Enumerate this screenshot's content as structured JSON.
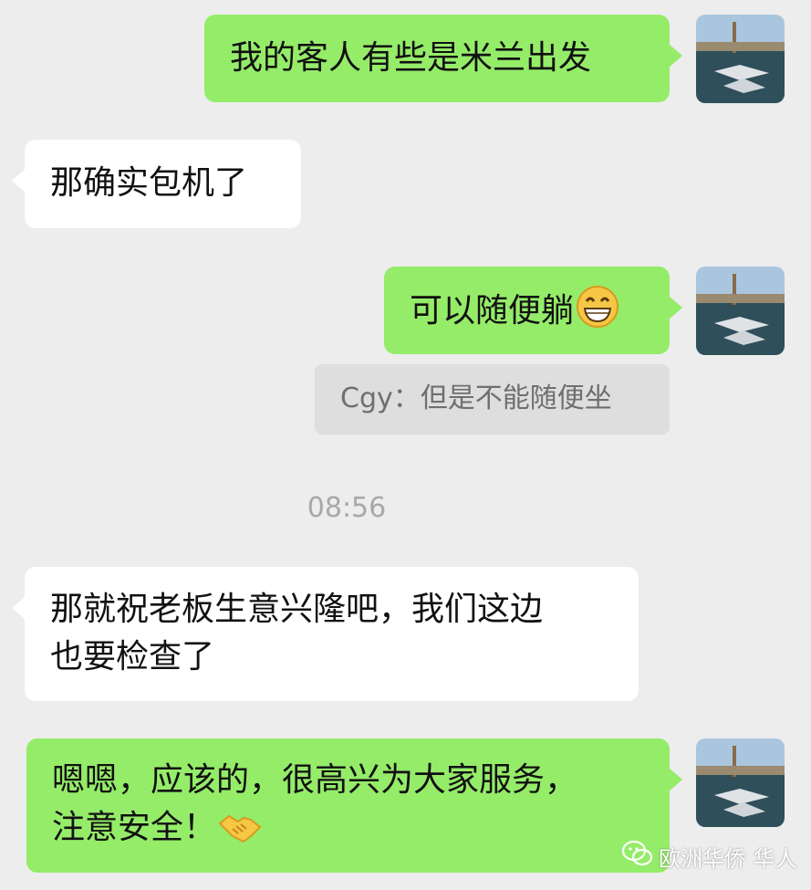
{
  "colors": {
    "background": "#ededed",
    "outgoing_bubble": "#95ec69",
    "incoming_bubble": "#ffffff",
    "quote_bg": "#dedede"
  },
  "messages": [
    {
      "direction": "outgoing",
      "text": "我的客人有些是米兰出发"
    },
    {
      "direction": "incoming",
      "text": "那确实包机了"
    },
    {
      "direction": "outgoing",
      "text": "可以随便躺",
      "emoji": "grinning-face-emoji"
    },
    {
      "direction": "incoming",
      "line1": "那就祝老板生意兴隆吧，我们这边",
      "line2": "也要检查了"
    },
    {
      "direction": "outgoing",
      "line1": "嗯嗯，应该的，很高兴为大家服务，",
      "line2": "注意安全！",
      "emoji": "handshake-emoji"
    }
  ],
  "quote": {
    "text": "Cgy：但是不能随便坐"
  },
  "timestamp": "08:56",
  "watermark": {
    "text": "欧洲华侨 华人",
    "icon": "wechat-icon"
  }
}
